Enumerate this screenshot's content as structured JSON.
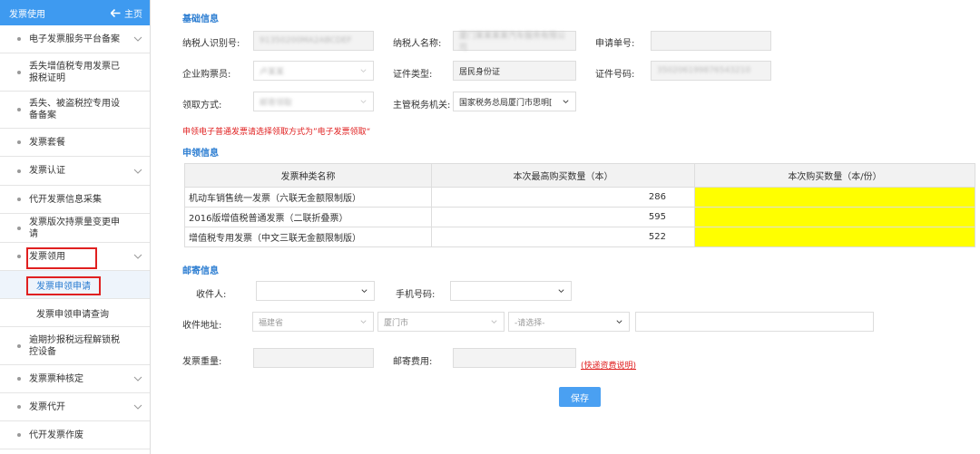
{
  "sidebar": {
    "header_title": "发票使用",
    "home_label": "主页",
    "items": [
      {
        "label": "电子发票服务平台备案",
        "chevron": true
      },
      {
        "label": "丢失增值税专用发票已报税证明",
        "chevron": false
      },
      {
        "label": "丢失、被盗税控专用设备备案",
        "chevron": false
      },
      {
        "label": "发票套餐",
        "chevron": false
      },
      {
        "label": "发票认证",
        "chevron": true
      },
      {
        "label": "代开发票信息采集",
        "chevron": false
      },
      {
        "label": "发票版次持票量变更申请",
        "chevron": false
      },
      {
        "label": "发票领用",
        "chevron": true
      }
    ],
    "subitems": [
      {
        "label": "发票申领申请",
        "active": true
      },
      {
        "label": "发票申领申请查询",
        "active": false
      }
    ],
    "items_after": [
      {
        "label": "逾期抄报税远程解锁税控设备",
        "chevron": false
      },
      {
        "label": "发票票种核定",
        "chevron": true
      },
      {
        "label": "发票代开",
        "chevron": true
      },
      {
        "label": "代开发票作废",
        "chevron": false
      }
    ]
  },
  "basic": {
    "title": "基础信息",
    "taxpayer_id_label": "纳税人识别号:",
    "taxpayer_id_value": "91350200MA2ABCDEF",
    "taxpayer_name_label": "纳税人名称:",
    "taxpayer_name_value": "厦门某某某某汽车服务有限公司",
    "application_no_label": "申请单号:",
    "application_no_value": "",
    "buyer_label": "企业购票员:",
    "buyer_value": "卢某某",
    "cert_type_label": "证件类型:",
    "cert_type_value": "居民身份证",
    "cert_no_label": "证件号码:",
    "cert_no_value": "350206199876543210",
    "receive_method_label": "领取方式:",
    "receive_method_value": "邮寄领取",
    "tax_authority_label": "主管税务机关:",
    "tax_authority_value": "国家税务总局厦门市思明["
  },
  "warning": "申领电子普通发票请选择领取方式为”电子发票领取“",
  "apply": {
    "title": "申领信息",
    "headers": [
      "发票种类名称",
      "本次最高购买数量（本）",
      "本次购买数量（本/份）"
    ],
    "rows": [
      {
        "name": "机动车销售统一发票（六联无金额限制版）",
        "max": "286"
      },
      {
        "name": "2016版增值税普通发票（二联折叠票）",
        "max": "595"
      },
      {
        "name": "增值税专用发票（中文三联无金额限制版）",
        "max": "522"
      }
    ]
  },
  "mail": {
    "title": "邮寄信息",
    "recipient_label": "收件人:",
    "phone_label": "手机号码:",
    "address_label": "收件地址:",
    "province": "福建省",
    "city": "厦门市",
    "district_placeholder": "-请选择-",
    "weight_label": "发票重量:",
    "fee_label": "邮寄费用:",
    "fee_link": "(快递资费说明)"
  },
  "save_label": "保存",
  "colors": {
    "accent": "#3e9af0",
    "highlight": "#ffff00",
    "warn": "#e02020"
  }
}
